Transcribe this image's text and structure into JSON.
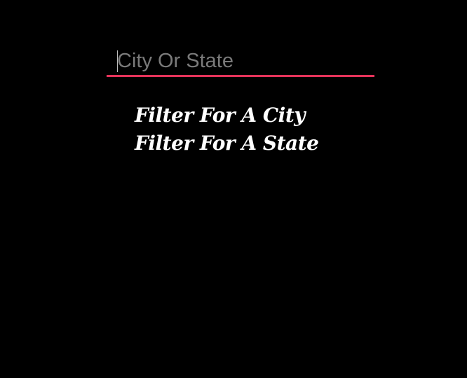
{
  "search": {
    "value": "",
    "placeholder": "City Or State"
  },
  "filters": {
    "items": [
      {
        "label": "Filter For A City"
      },
      {
        "label": "Filter For A State"
      }
    ]
  },
  "colors": {
    "background": "#000000",
    "accent_underline": "#e5335a",
    "placeholder": "#7a7a7a",
    "text": "#ffffff"
  }
}
